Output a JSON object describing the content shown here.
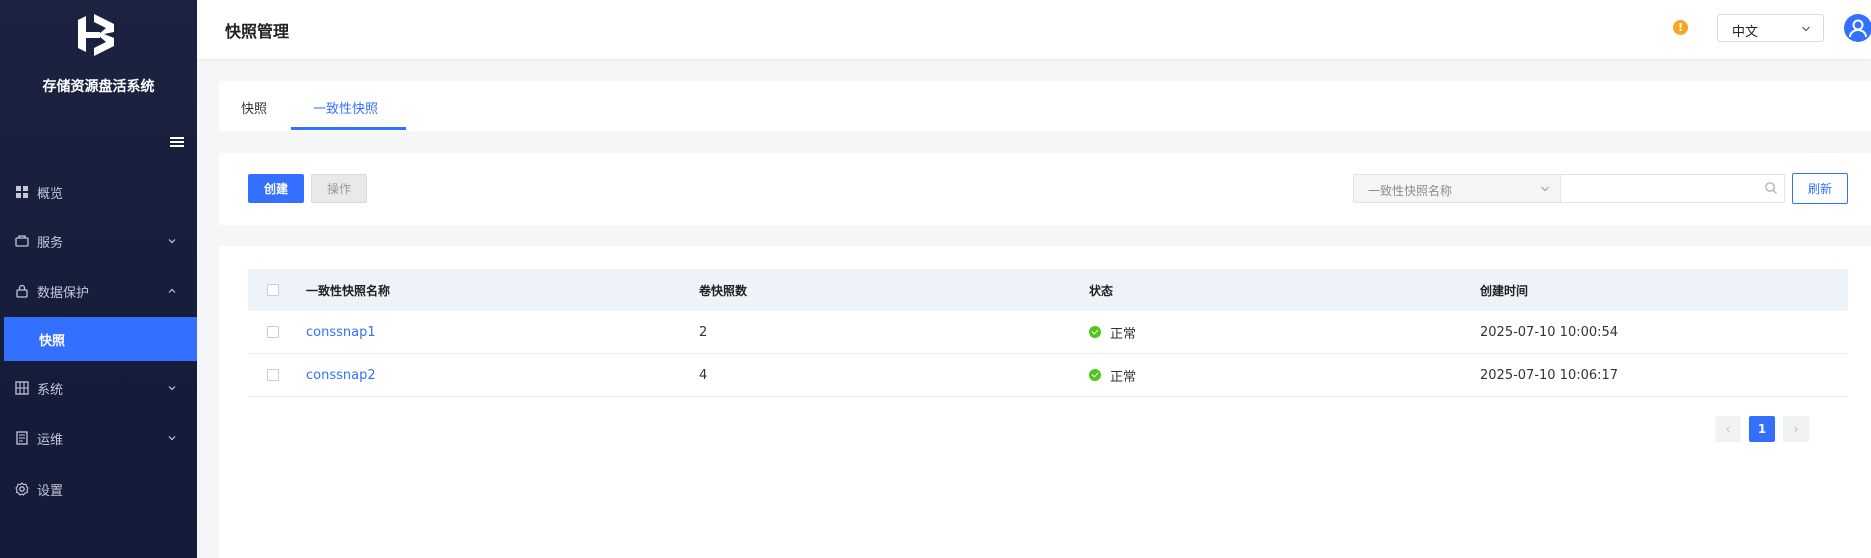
{
  "sidebar": {
    "system_title": "存储资源盘活系统",
    "items": [
      {
        "label": "概览",
        "icon": "dashboard-icon"
      },
      {
        "label": "服务",
        "icon": "service-icon"
      },
      {
        "label": "数据保护",
        "icon": "lock-icon"
      },
      {
        "label": "快照",
        "icon": "",
        "active": true
      },
      {
        "label": "系统",
        "icon": "system-icon"
      },
      {
        "label": "运维",
        "icon": "ops-icon"
      },
      {
        "label": "设置",
        "icon": "gear-icon"
      }
    ]
  },
  "header": {
    "title": "快照管理",
    "warning_mark": "!",
    "language": "中文"
  },
  "tabs": [
    {
      "label": "快照",
      "active": false
    },
    {
      "label": "一致性快照",
      "active": true
    }
  ],
  "toolbar": {
    "create_label": "创建",
    "operate_label": "操作",
    "search_field_placeholder": "一致性快照名称",
    "search_input_value": "",
    "refresh_label": "刷新"
  },
  "table": {
    "columns": [
      "一致性快照名称",
      "卷快照数",
      "状态",
      "创建时间"
    ],
    "rows": [
      {
        "name": "conssnap1",
        "count": "2",
        "status": "正常",
        "created": "2025-07-10 10:00:54"
      },
      {
        "name": "conssnap2",
        "count": "4",
        "status": "正常",
        "created": "2025-07-10 10:06:17"
      }
    ]
  },
  "pagination": {
    "current": "1",
    "prev_label": "‹",
    "next_label": "›"
  },
  "colors": {
    "primary": "#3370ff",
    "sidebar_bg": "#1b2341",
    "success": "#52c41a",
    "warning": "#f5a623"
  }
}
